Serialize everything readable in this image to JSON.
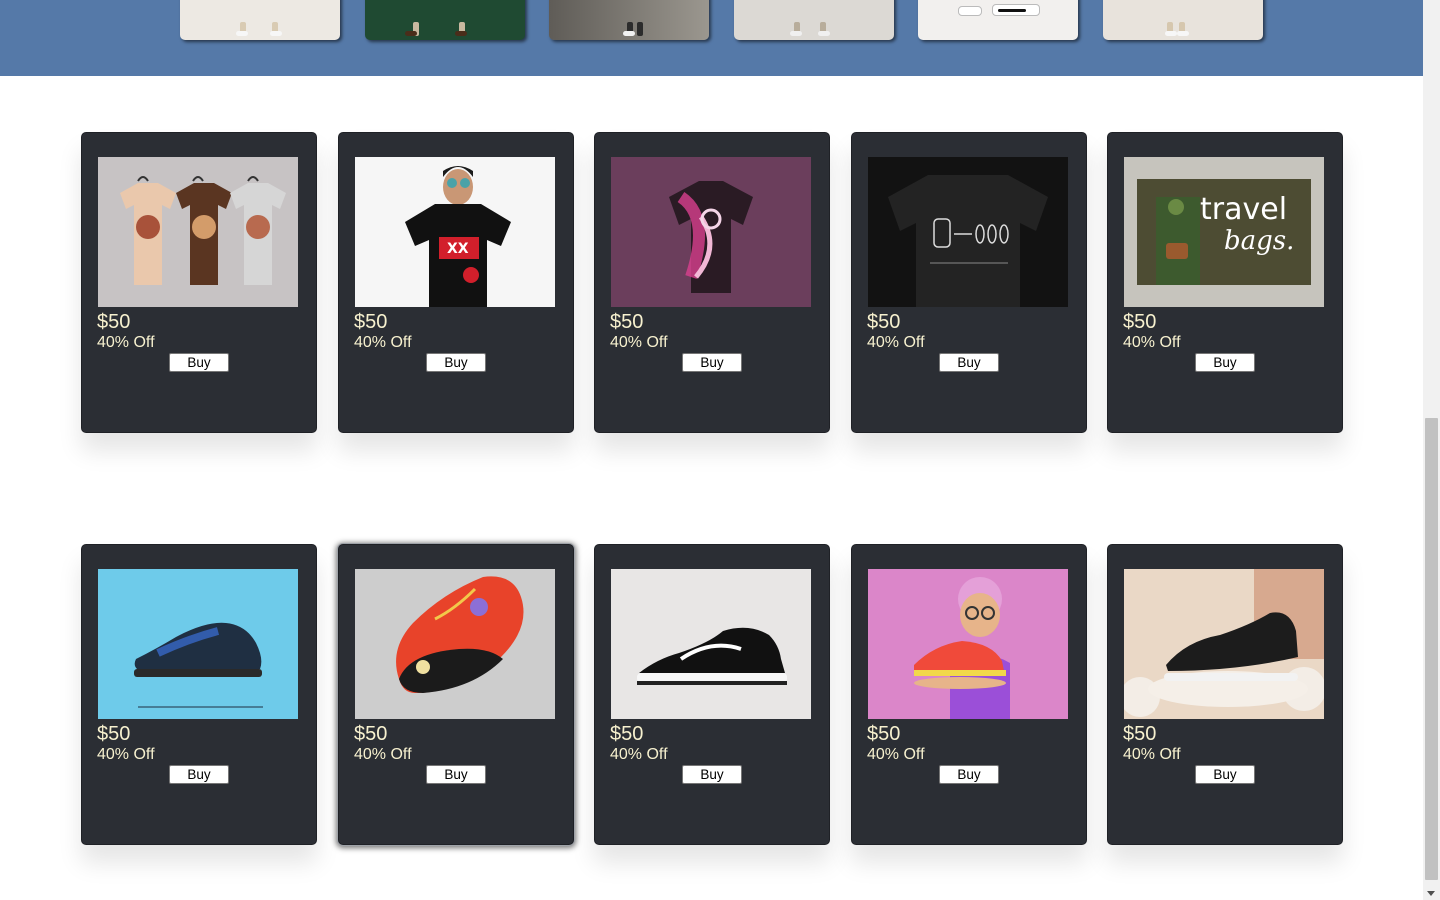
{
  "gallery": {
    "items": [
      {
        "icon": "model-legs-cream-pants",
        "color": "#ede9e3"
      },
      {
        "icon": "model-legs-green-backdrop",
        "color": "#1f4a32"
      },
      {
        "icon": "model-legs-street",
        "color": "#7a7670"
      },
      {
        "icon": "model-legs-light-pants",
        "color": "#dcd9d4"
      },
      {
        "icon": "sneakers-white",
        "color": "#f2f0ee"
      },
      {
        "icon": "model-legs-beige",
        "color": "#e8e3dc"
      }
    ]
  },
  "products": {
    "row1": [
      {
        "image": "tshirts-trio-image",
        "price": "$50",
        "discount": "40% Off",
        "buy_label": "Buy"
      },
      {
        "image": "man-black-tshirt-image",
        "price": "$50",
        "discount": "40% Off",
        "buy_label": "Buy"
      },
      {
        "image": "pink-shirt-image",
        "price": "$50",
        "discount": "40% Off",
        "buy_label": "Buy"
      },
      {
        "image": "black-camera-tshirt-image",
        "price": "$50",
        "discount": "40% Off",
        "buy_label": "Buy"
      },
      {
        "image": "travel-bags-image",
        "price": "$50",
        "discount": "40% Off",
        "buy_label": "Buy",
        "image_text": [
          "travel",
          "bags."
        ]
      }
    ],
    "row2": [
      {
        "image": "blue-sneaker-image",
        "price": "$50",
        "discount": "40% Off",
        "buy_label": "Buy"
      },
      {
        "image": "red-sneaker-image",
        "price": "$50",
        "discount": "40% Off",
        "buy_label": "Buy"
      },
      {
        "image": "black-white-sneakers-image",
        "price": "$50",
        "discount": "40% Off",
        "buy_label": "Buy"
      },
      {
        "image": "running-shoe-hand-image",
        "price": "$50",
        "discount": "40% Off",
        "buy_label": "Buy"
      },
      {
        "image": "black-sneaker-podium-image",
        "price": "$50",
        "discount": "40% Off",
        "buy_label": "Buy"
      }
    ]
  },
  "colors": {
    "banner": "#5579a8",
    "card": "#2b2e34",
    "price_text": "#f7f1cf"
  }
}
